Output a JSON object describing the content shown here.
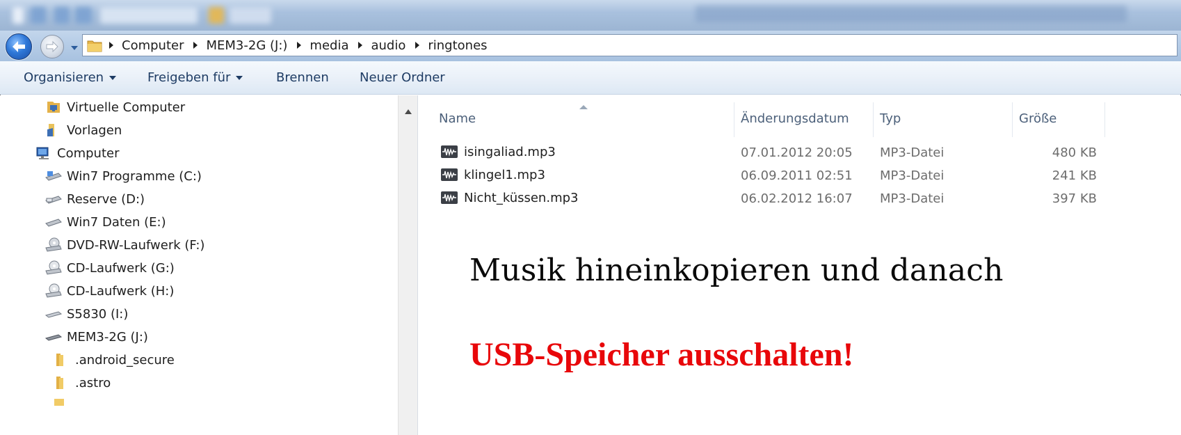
{
  "address": {
    "breadcrumbs": [
      "Computer",
      "MEM3-2G (J:)",
      "media",
      "audio",
      "ringtones"
    ]
  },
  "toolbar": {
    "organize_label": "Organisieren",
    "share_label": "Freigeben für",
    "burn_label": "Brennen",
    "new_folder_label": "Neuer Ordner"
  },
  "nav": {
    "items": [
      {
        "label": "Virtuelle Computer",
        "icon": "virtual-pc-icon"
      },
      {
        "label": "Vorlagen",
        "icon": "templates-folder-icon"
      },
      {
        "label": "Computer",
        "icon": "computer-icon"
      },
      {
        "label": "Win7 Programme (C:)",
        "icon": "system-drive-icon"
      },
      {
        "label": "Reserve (D:)",
        "icon": "hard-drive-icon"
      },
      {
        "label": "Win7 Daten (E:)",
        "icon": "hard-drive-icon"
      },
      {
        "label": "DVD-RW-Laufwerk (F:)",
        "icon": "dvd-drive-icon"
      },
      {
        "label": "CD-Laufwerk (G:)",
        "icon": "cd-drive-icon"
      },
      {
        "label": "CD-Laufwerk (H:)",
        "icon": "cd-drive-icon"
      },
      {
        "label": "S5830 (I:)",
        "icon": "removable-drive-icon"
      },
      {
        "label": "MEM3-2G (J:)",
        "icon": "removable-drive-icon"
      },
      {
        "label": ".android_secure",
        "icon": "folder-icon"
      },
      {
        "label": ".astro",
        "icon": "folder-icon"
      }
    ]
  },
  "columns": {
    "name": "Name",
    "date": "Änderungsdatum",
    "type": "Typ",
    "size": "Größe"
  },
  "files": [
    {
      "name": "isingaliad.mp3",
      "date": "07.01.2012 20:05",
      "type": "MP3-Datei",
      "size": "480 KB"
    },
    {
      "name": "klingel1.mp3",
      "date": "06.09.2011 02:51",
      "type": "MP3-Datei",
      "size": "241 KB"
    },
    {
      "name": "Nicht_küssen.mp3",
      "date": "06.02.2012 16:07",
      "type": "MP3-Datei",
      "size": "397 KB"
    }
  ],
  "instructions": {
    "line1": "Musik hineinkopieren und danach",
    "line2": "USB-Speicher ausschalten!"
  },
  "colors": {
    "accent": "#e8070a",
    "toolbar_text": "#1e3c64"
  }
}
